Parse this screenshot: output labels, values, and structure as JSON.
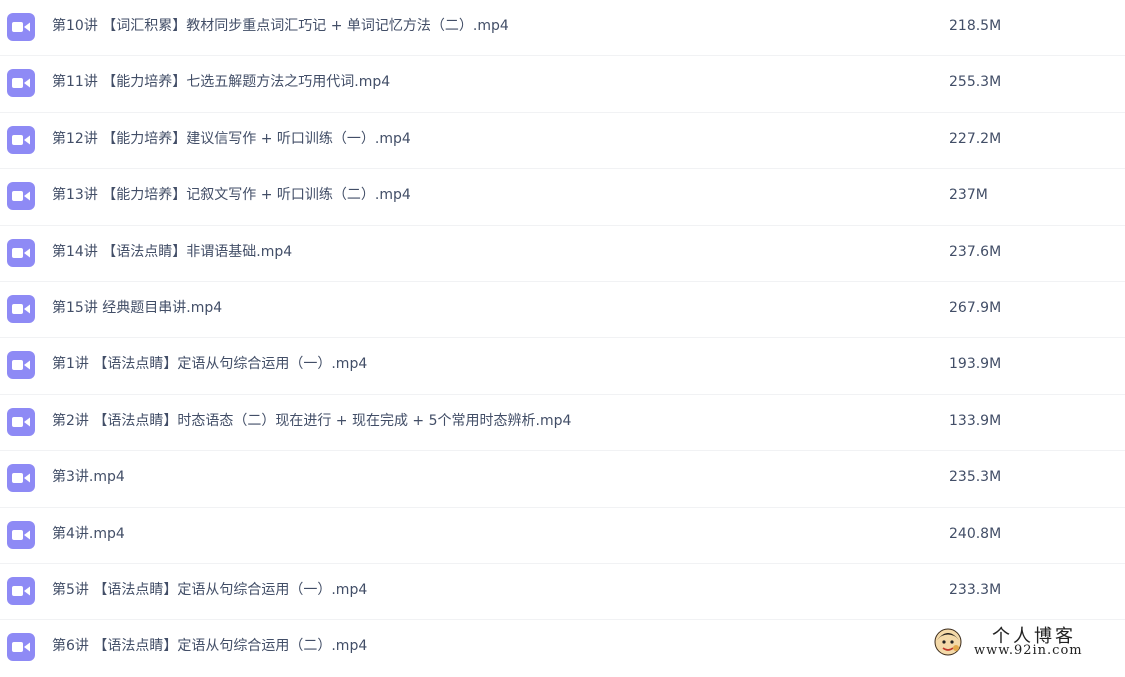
{
  "files": [
    {
      "name": "第10讲 【词汇积累】教材同步重点词汇巧记 + 单词记忆方法（二）.mp4",
      "size": "218.5M",
      "icon": "video-file-icon"
    },
    {
      "name": "第11讲 【能力培养】七选五解题方法之巧用代词.mp4",
      "size": "255.3M",
      "icon": "video-file-icon"
    },
    {
      "name": "第12讲 【能力培养】建议信写作 + 听口训练（一）.mp4",
      "size": "227.2M",
      "icon": "video-file-icon"
    },
    {
      "name": "第13讲 【能力培养】记叙文写作 + 听口训练（二）.mp4",
      "size": "237M",
      "icon": "video-file-icon"
    },
    {
      "name": "第14讲 【语法点睛】非谓语基础.mp4",
      "size": "237.6M",
      "icon": "video-file-icon"
    },
    {
      "name": "第15讲 经典题目串讲.mp4",
      "size": "267.9M",
      "icon": "video-file-icon"
    },
    {
      "name": "第1讲 【语法点睛】定语从句综合运用（一）.mp4",
      "size": "193.9M",
      "icon": "video-file-icon"
    },
    {
      "name": "第2讲 【语法点睛】时态语态（二）现在进行 + 现在完成 + 5个常用时态辨析.mp4",
      "size": "133.9M",
      "icon": "video-file-icon"
    },
    {
      "name": "第3讲.mp4",
      "size": "235.3M",
      "icon": "video-file-icon"
    },
    {
      "name": "第4讲.mp4",
      "size": "240.8M",
      "icon": "video-file-icon"
    },
    {
      "name": "第5讲 【语法点睛】定语从句综合运用（一）.mp4",
      "size": "233.3M",
      "icon": "video-file-icon"
    },
    {
      "name": "第6讲 【语法点睛】定语从句综合运用（二）.mp4",
      "size": "",
      "icon": "video-file-icon"
    }
  ],
  "watermark": {
    "title": "个人博客",
    "url": "www.92in.com"
  },
  "colors": {
    "icon_bg": "#8e8af5",
    "text": "#424e67",
    "divider": "#f1f2f4"
  }
}
